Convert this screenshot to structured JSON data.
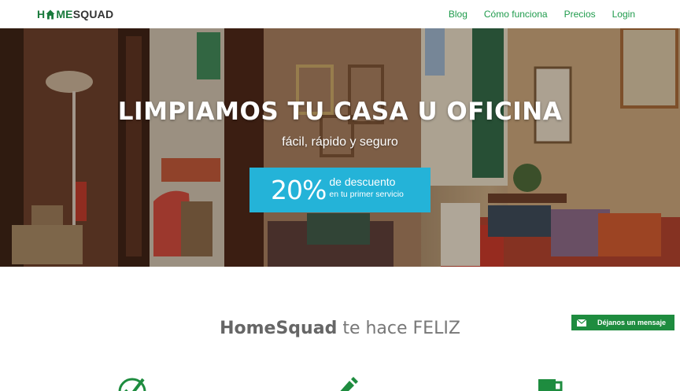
{
  "brand": {
    "part1": "H",
    "part2": "ME",
    "part3": "SQUAD",
    "icon": "house-icon"
  },
  "nav": [
    {
      "label": "Blog"
    },
    {
      "label": "Cómo funciona"
    },
    {
      "label": "Precios"
    },
    {
      "label": "Login"
    }
  ],
  "hero": {
    "title": "LIMPIAMOS TU CASA U OFICINA",
    "subtitle": "fácil, rápido y seguro",
    "promo": {
      "percent": "20%",
      "line1": "de descuento",
      "line2": "en tu primer servicio",
      "color": "#24b3d8"
    }
  },
  "section": {
    "title_bold": "HomeSquad",
    "title_rest": " te hace FELIZ"
  },
  "feedback": {
    "label": "Déjanos un mensaje",
    "icon": "mail-icon",
    "color": "#1e8c3f"
  },
  "features": [
    {
      "icon": "check-circle-icon"
    },
    {
      "icon": "pencil-icon"
    },
    {
      "icon": "mug-icon"
    }
  ],
  "colors": {
    "accent_green": "#1f9b4c",
    "promo_blue": "#24b3d8"
  }
}
